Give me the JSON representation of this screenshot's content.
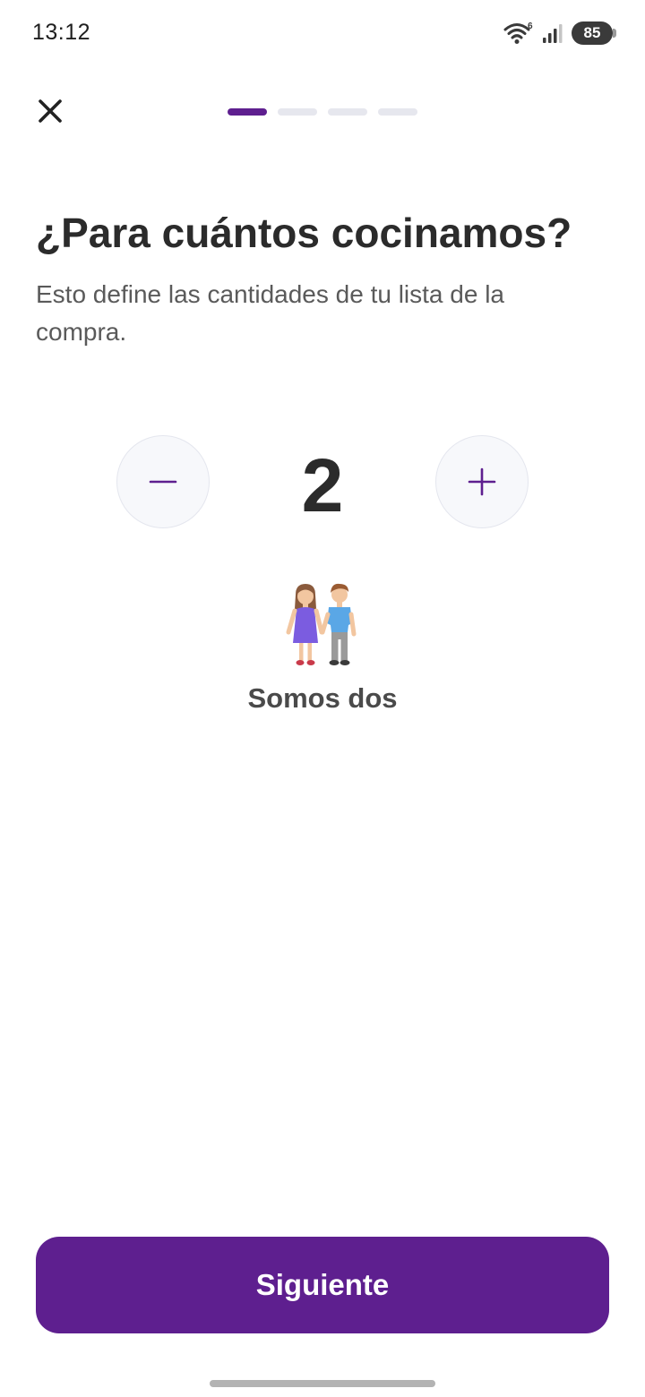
{
  "status_bar": {
    "time": "13:12",
    "wifi_badge": "6",
    "battery": "85",
    "icons": [
      "wifi-icon",
      "signal-icon",
      "battery-icon"
    ]
  },
  "header": {
    "close_icon": "close-icon",
    "progress": {
      "current_step": 1,
      "total_steps": 4
    }
  },
  "main": {
    "title": "¿Para cuántos cocinamos?",
    "subtitle": "Esto define las cantidades de tu lista de la compra.",
    "stepper": {
      "value": "2",
      "decrement_icon": "minus-icon",
      "increment_icon": "plus-icon"
    },
    "illustration": "couple-holding-hands-emoji",
    "people_label": "Somos dos"
  },
  "footer": {
    "next_label": "Siguiente"
  },
  "colors": {
    "accent": "#5e1f8f",
    "progress_inactive": "#e6e7ee",
    "text_primary": "#2b2b2b",
    "text_secondary": "#5a5a5a",
    "stepper_bg": "#f7f8fb"
  }
}
